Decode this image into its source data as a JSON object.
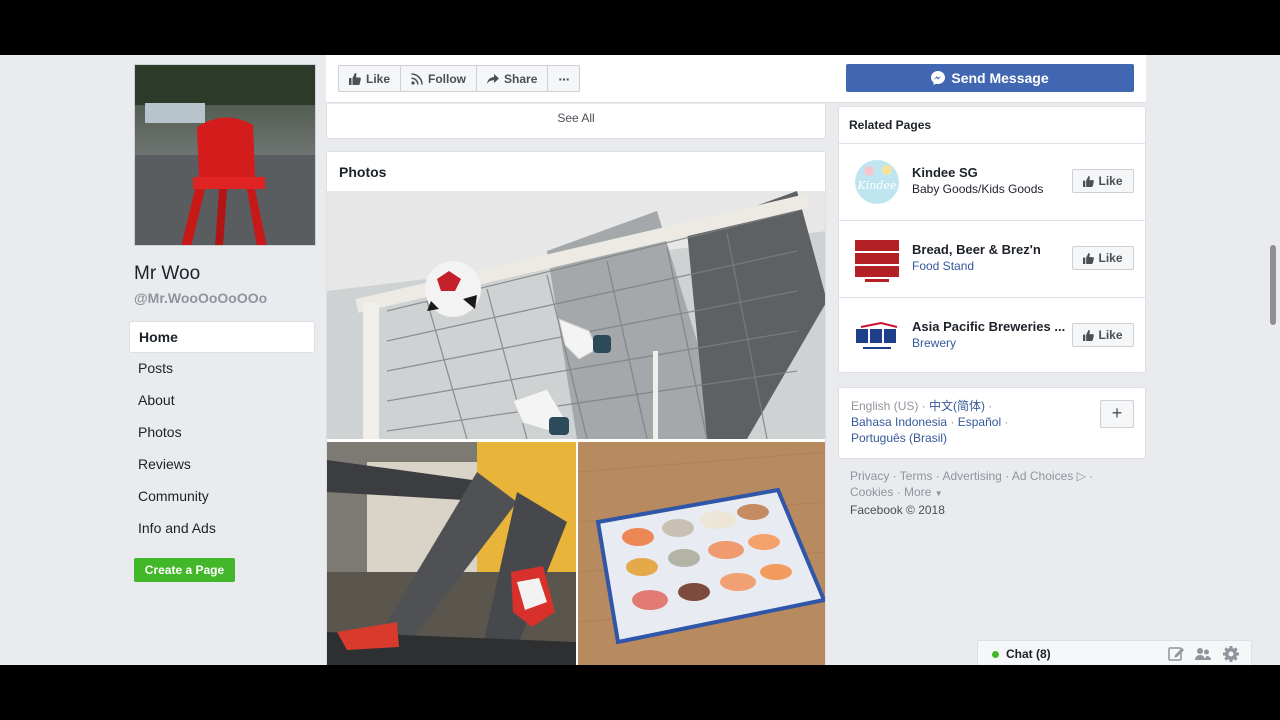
{
  "profile": {
    "name": "Mr Woo",
    "handle": "@Mr.WooOoOoOOo"
  },
  "nav": {
    "items": [
      {
        "label": "Home",
        "active": true
      },
      {
        "label": "Posts"
      },
      {
        "label": "About"
      },
      {
        "label": "Photos"
      },
      {
        "label": "Reviews"
      },
      {
        "label": "Community"
      },
      {
        "label": "Info and Ads"
      }
    ],
    "create_page_label": "Create a Page"
  },
  "actions": {
    "like_label": "Like",
    "follow_label": "Follow",
    "share_label": "Share",
    "more_label": "···",
    "send_message_label": "Send Message"
  },
  "feed": {
    "see_all_label": "See All",
    "photos_title": "Photos"
  },
  "related": {
    "title": "Related Pages",
    "items": [
      {
        "name": "Kindee SG",
        "category": "Baby Goods/Kids Goods",
        "like_label": "Like"
      },
      {
        "name": "Bread, Beer & Brez'n",
        "category": "Food Stand",
        "like_label": "Like"
      },
      {
        "name": "Asia Pacific Breweries ...",
        "category": "Brewery",
        "like_label": "Like"
      }
    ]
  },
  "languages": {
    "current": "English (US)",
    "options": [
      "中文(简体)",
      "Bahasa Indonesia",
      "Español",
      "Português (Brasil)"
    ]
  },
  "footer": {
    "links": [
      "Privacy",
      "Terms",
      "Advertising",
      "Ad Choices",
      "Cookies",
      "More"
    ],
    "copyright": "Facebook © 2018"
  },
  "chat": {
    "label": "Chat (8)"
  },
  "colors": {
    "brand_blue": "#4267b2",
    "link_blue": "#365899",
    "green": "#42b72a",
    "background": "#e9ebee"
  }
}
